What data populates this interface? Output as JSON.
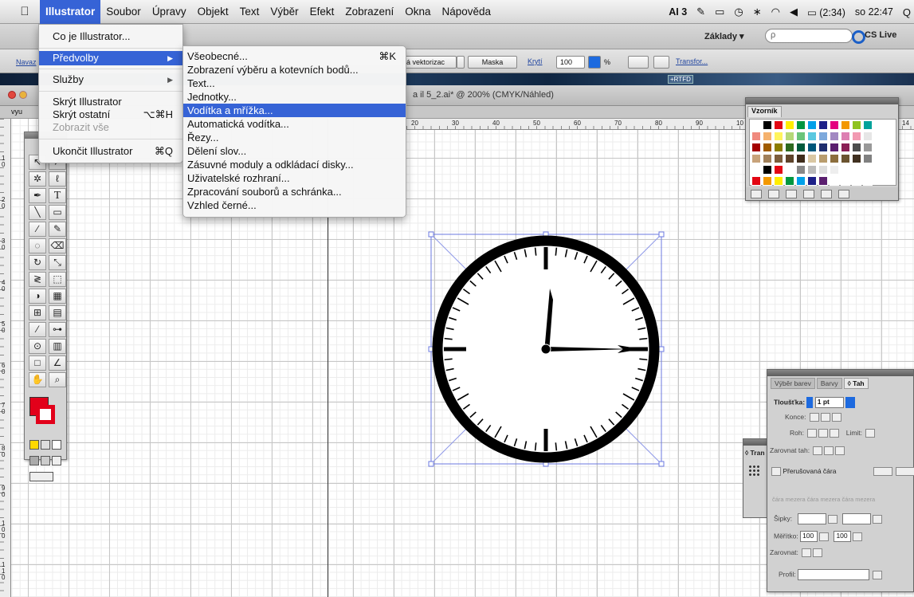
{
  "menubar": {
    "apple_icon": "apple-icon",
    "items": [
      "Illustrator",
      "Soubor",
      "Úpravy",
      "Objekt",
      "Text",
      "Výběr",
      "Efekt",
      "Zobrazení",
      "Okna",
      "Nápověda"
    ],
    "status": {
      "ai_badge": "AI 3",
      "battery": "(2:34)",
      "clock": "so 22:47"
    }
  },
  "app_menu": {
    "items": [
      {
        "label": "Co je Illustrator..."
      },
      {
        "label": "Předvolby",
        "submenu": true,
        "highlighted": true
      },
      {
        "label": "Služby",
        "submenu": true
      },
      {
        "label": "Skrýt Illustrator"
      },
      {
        "label": "Skrýt ostatní",
        "shortcut": "⌥⌘H"
      },
      {
        "label": "Zobrazit vše",
        "disabled": true
      },
      {
        "label": "Ukončit Illustrator",
        "shortcut": "⌘Q"
      }
    ]
  },
  "prefs_menu": {
    "items": [
      {
        "label": "Všeobecné...",
        "shortcut": "⌘K"
      },
      {
        "label": "Zobrazení výběru a kotevních bodů..."
      },
      {
        "label": "Text..."
      },
      {
        "label": "Jednotky..."
      },
      {
        "label": "Vodítka a mřížka...",
        "highlighted": true
      },
      {
        "label": "Automatická vodítka..."
      },
      {
        "label": "Řezy..."
      },
      {
        "label": "Dělení slov..."
      },
      {
        "label": "Zásuvné moduly a odkládací disky..."
      },
      {
        "label": "Uživatelské rozhraní..."
      },
      {
        "label": "Zpracování souborů a schránka..."
      },
      {
        "label": "Vzhled černé..."
      }
    ]
  },
  "appbar": {
    "workspace": "Základy ▾",
    "search_placeholder": "ρ",
    "cs_live": "CS Live"
  },
  "control_bar": {
    "left_label": "Navaz",
    "vectorize": "á vektorizac",
    "mask": "Maska",
    "opacity_label": "Krytí",
    "opacity_value": "100",
    "percent": "%",
    "transform_link": "Transfor...",
    "rtfd": "+RTFD"
  },
  "document": {
    "title": "a il 5_2.ai* @ 200% (CMYK/Náhled)",
    "tab_left": "vyu"
  },
  "rulers": {
    "h_ticks": [
      "20",
      "30",
      "40",
      "50",
      "60",
      "70",
      "80",
      "90",
      "10",
      "14"
    ],
    "v_ticks": [
      "1 0",
      "2 0",
      "3 0",
      "4 0",
      "5 0",
      "6 0",
      "7 0",
      "8 0",
      "9 0",
      "1 0 0",
      "1 1 0"
    ]
  },
  "swatches_panel": {
    "tab": "Vzorník"
  },
  "stroke_panel": {
    "tabs": [
      "Výběr barev",
      "Barvy",
      "◊ Tah"
    ],
    "weight_label": "Tloušťka:",
    "weight_value": "1 pt",
    "cap_label": "Konce:",
    "join_label": "Roh:",
    "limit_label": "Limit:",
    "align_label": "Zarovnat tah:",
    "dashed_label": "Přerušovaná čára",
    "dash_labels": "čára   mezera   čára   mezera   čára   mezera",
    "arrows_label": "Šipky:",
    "scale_label": "Měřítko:",
    "scale_value1": "100",
    "scale_value2": "100",
    "align2_label": "Zarovnat:",
    "profile_label": "Profil:"
  },
  "transform_panel": {
    "label": "◊ Tran"
  }
}
